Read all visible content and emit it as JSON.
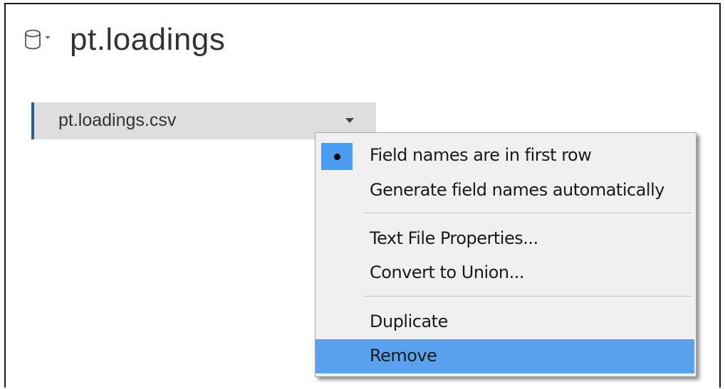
{
  "datasource": {
    "title": "pt.loadings",
    "icon": "database-icon",
    "dropdown_icon": "chevron-down-icon"
  },
  "table": {
    "name": "pt.loadings.csv",
    "dropdown_icon": "triangle-down-icon",
    "accent_color": "#2e5f8a"
  },
  "context_menu": {
    "items": [
      {
        "label": "Field names are in first row",
        "checked": true
      },
      {
        "label": "Generate field names automatically",
        "checked": false
      },
      {
        "label": "Text File Properties...",
        "checked": false
      },
      {
        "label": "Convert to Union...",
        "checked": false
      },
      {
        "label": "Duplicate",
        "checked": false
      },
      {
        "label": "Remove",
        "checked": false,
        "highlighted": true
      }
    ],
    "highlight_color": "#5aa2f0",
    "check_color": "#4a9cf0"
  }
}
